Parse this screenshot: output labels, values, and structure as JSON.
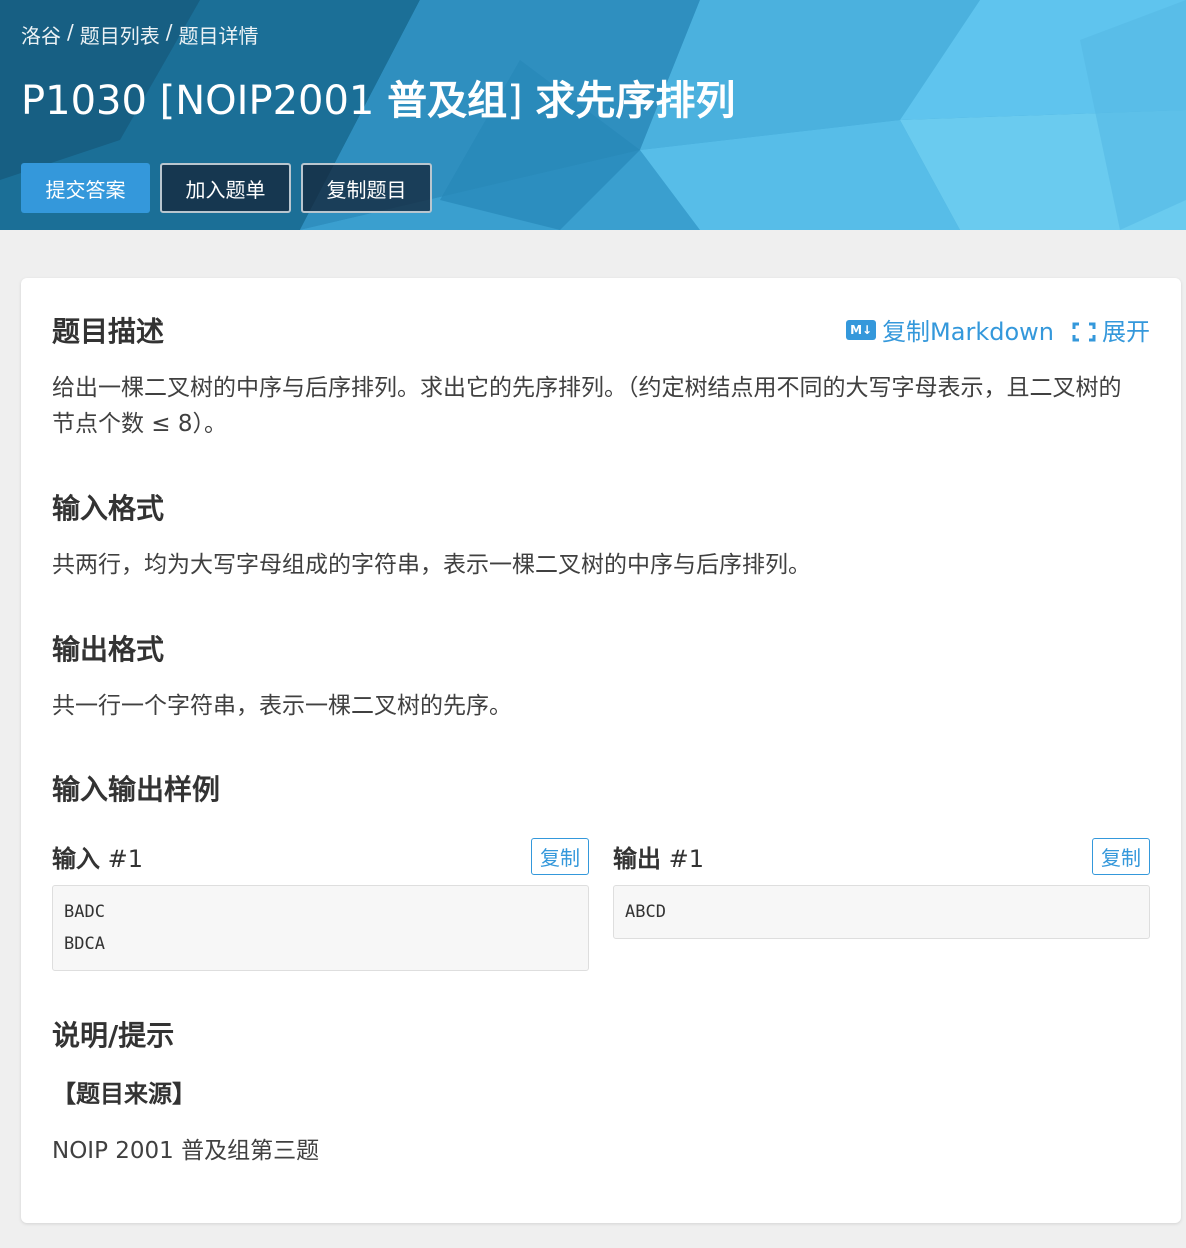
{
  "colors": {
    "brand_blue": "#3498db",
    "header_bg": "#3aa0d0",
    "page_bg": "#efefef",
    "card_bg": "#ffffff"
  },
  "breadcrumb": {
    "site": "洛谷",
    "sep1": "/",
    "list": "题目列表",
    "sep2": "/",
    "detail": "题目详情"
  },
  "title": {
    "prefix": "P1030 [NOIP2001 ",
    "bold1": "普及组",
    "middle": "] ",
    "bold2": "求先序排列"
  },
  "actions": {
    "submit": "提交答案",
    "add_to_list": "加入题单",
    "copy_problem": "复制题目"
  },
  "tools": {
    "md_icon_text": "M↓",
    "copy_markdown": "复制Markdown",
    "expand": "展开"
  },
  "sections": {
    "description_title": "题目描述",
    "description_text": "给出一棵二叉树的中序与后序排列。求出它的先序排列。（约定树结点用不同的大写字母表示，且二叉树的节点个数 ≤ 8）。",
    "input_title": "输入格式",
    "input_text": "共两行，均为大写字母组成的字符串，表示一棵二叉树的中序与后序排列。",
    "output_title": "输出格式",
    "output_text": "共一行一个字符串，表示一棵二叉树的先序。",
    "samples_title": "输入输出样例",
    "hint_title": "说明/提示",
    "source_label": "【题目来源】",
    "source_text": "NOIP 2001 普及组第三题"
  },
  "samples": {
    "input_label": "输入",
    "input_num": "#1",
    "output_label": "输出",
    "output_num": "#1",
    "copy": "复制",
    "input_lines": [
      "BADC",
      "BDCA"
    ],
    "output_lines": [
      "ABCD"
    ]
  }
}
